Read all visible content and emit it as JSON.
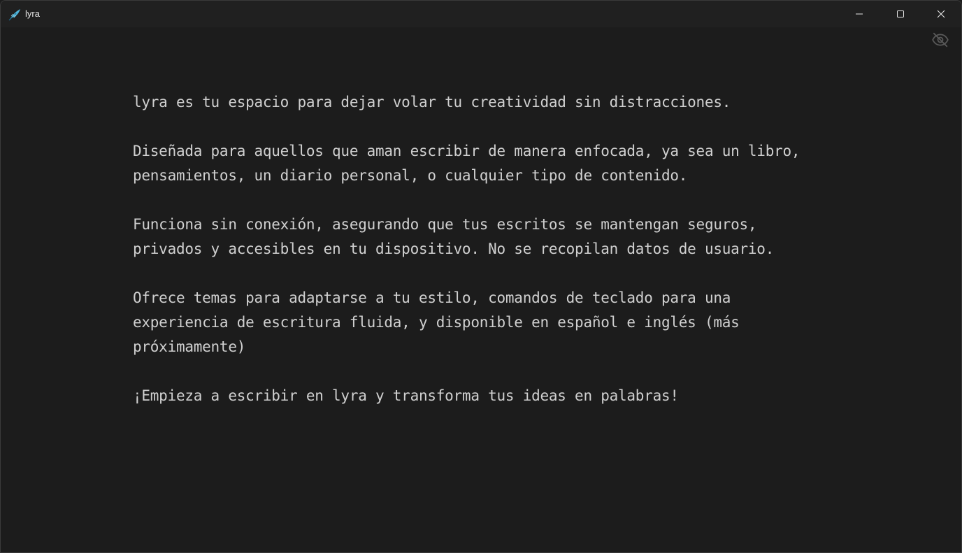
{
  "window": {
    "title": "lyra",
    "app_icon": "feather-icon",
    "controls": {
      "minimize_icon": "minimize-icon",
      "maximize_icon": "maximize-icon",
      "close_icon": "close-icon"
    }
  },
  "toolbar": {
    "focus_toggle_icon": "eye-off-icon"
  },
  "editor": {
    "paragraphs": [
      "lyra es tu espacio para dejar volar tu creatividad sin distracciones.",
      "Diseñada para aquellos que aman escribir de manera enfocada, ya sea un libro, pensamientos, un diario personal, o cualquier tipo de contenido.",
      "Funciona sin conexión, asegurando que tus escritos se mantengan seguros, privados y accesibles en tu dispositivo. No se recopilan datos de usuario.",
      "Ofrece temas para adaptarse a tu estilo, comandos de teclado para una experiencia de escritura fluida, y disponible en español e inglés (más próximamente)",
      "¡Empieza a escribir en lyra y transforma tus ideas en palabras!"
    ]
  },
  "colors": {
    "background": "#1c1c1c",
    "titlebar": "#202020",
    "text": "#d0d0d0",
    "icon_muted": "#5a5a5a",
    "accent": "#4fb3d9"
  }
}
